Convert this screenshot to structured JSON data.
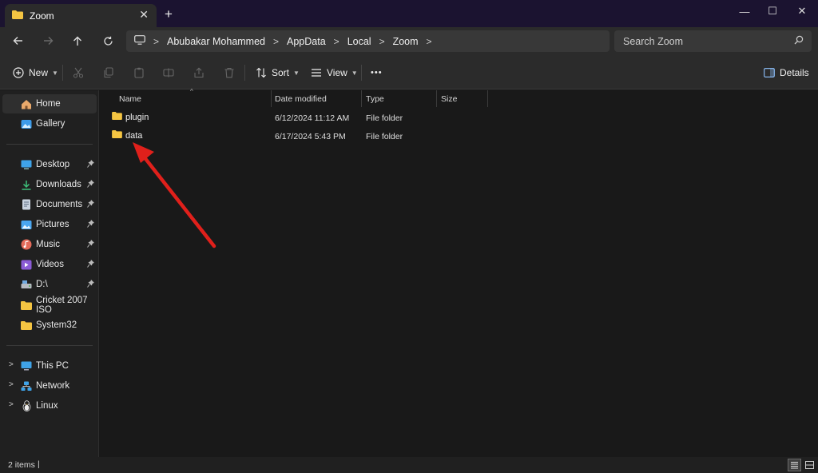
{
  "window": {
    "tab_title": "Zoom",
    "new_tab": "+",
    "close_tab": "✕",
    "minimize": "—",
    "maximize": "☐",
    "close": "✕"
  },
  "address": {
    "breadcrumbs": [
      "Abubakar Mohammed",
      "AppData",
      "Local",
      "Zoom"
    ],
    "search_placeholder": "Search Zoom"
  },
  "toolbar": {
    "new_label": "New",
    "sort_label": "Sort",
    "view_label": "View",
    "more_label": "•••",
    "details_label": "Details"
  },
  "sidebar": {
    "top_items": [
      {
        "label": "Home",
        "icon": "home-icon"
      },
      {
        "label": "Gallery",
        "icon": "gallery-icon"
      }
    ],
    "quick_access": [
      {
        "label": "Desktop",
        "icon": "desktop-icon",
        "pinned": true
      },
      {
        "label": "Downloads",
        "icon": "download-icon",
        "pinned": true
      },
      {
        "label": "Documents",
        "icon": "documents-icon",
        "pinned": true
      },
      {
        "label": "Pictures",
        "icon": "pictures-icon",
        "pinned": true
      },
      {
        "label": "Music",
        "icon": "music-icon",
        "pinned": true
      },
      {
        "label": "Videos",
        "icon": "videos-icon",
        "pinned": true
      },
      {
        "label": "D:\\",
        "icon": "drive-icon",
        "pinned": true
      },
      {
        "label": "Cricket 2007 ISO",
        "icon": "folder-icon",
        "pinned": false
      },
      {
        "label": "System32",
        "icon": "folder-icon",
        "pinned": false
      }
    ],
    "tree": [
      {
        "label": "This PC",
        "icon": "pc-icon"
      },
      {
        "label": "Network",
        "icon": "network-icon"
      },
      {
        "label": "Linux",
        "icon": "linux-icon"
      }
    ]
  },
  "columns": {
    "name": "Name",
    "date_modified": "Date modified",
    "type": "Type",
    "size": "Size"
  },
  "files": [
    {
      "name": "plugin",
      "date_modified": "6/12/2024 11:12 AM",
      "type": "File folder",
      "size": ""
    },
    {
      "name": "data",
      "date_modified": "6/17/2024 5:43 PM",
      "type": "File folder",
      "size": ""
    }
  ],
  "status": {
    "item_count": "2 items",
    "caret": "|"
  },
  "colors": {
    "accent_folder": "#f5c542",
    "annotation_arrow": "#e0201b",
    "titlebar": "#1b1330"
  }
}
